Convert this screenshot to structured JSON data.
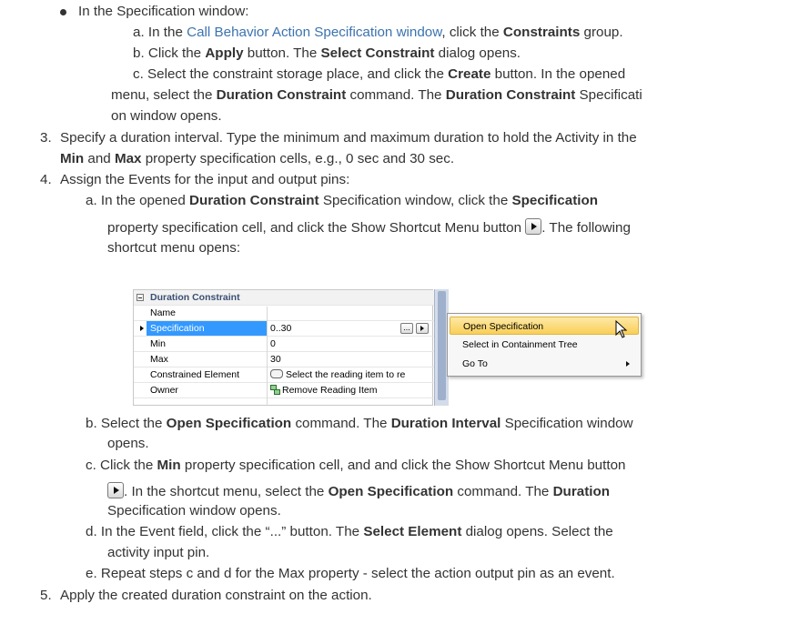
{
  "doc": {
    "bullet": {
      "intro": "In the Specification window:",
      "a_pre": "a. In the ",
      "a_link": "Call Behavior Action Specification window",
      "a_mid": ", click the ",
      "a_bold": "Constraints",
      "a_post": " group.",
      "b_pre": "b. Click the ",
      "b_bold1": "Apply",
      "b_mid": " button. The ",
      "b_bold2": "Select Constraint",
      "b_post": " dialog opens.",
      "c_pre": "c. Select the constraint storage place, and click the ",
      "c_bold1": "Create",
      "c_mid1": " button. In the opened",
      "c2_pre": "menu, select the ",
      "c2_bold1": "Duration Constraint",
      "c2_mid": " command. The ",
      "c2_bold2": "Duration Constraint",
      "c2_post": " Specificati",
      "c3": "on window opens."
    },
    "step3": {
      "num": "3.",
      "l1": "Specify a duration interval. Type the minimum and maximum duration to hold the Activity in the",
      "l2_bold1": "Min",
      "l2_mid": " and ",
      "l2_bold2": "Max",
      "l2_post": " property specification cells, e.g., 0 sec and 30 sec."
    },
    "step4": {
      "num": "4.",
      "l1": "Assign the Events for the input and output pins:",
      "a_pre": "a. In the opened ",
      "a_bold1": "Duration Constraint",
      "a_mid": " Specification window, click the ",
      "a_bold2": "Specification",
      "a2_pre": "property specification cell, and click the Show Shortcut Menu button ",
      "a2_post": ". The following",
      "a3": "shortcut menu opens:",
      "b_pre": "b. Select the ",
      "b_bold1": "Open Specification",
      "b_mid": " command. The ",
      "b_bold2": "Duration Interval",
      "b_post": " Specification window",
      "b2": "opens.",
      "c_pre": "c. Click the ",
      "c_bold": "Min",
      "c_post": " property specification cell, and and click the Show Shortcut Menu button",
      "c2_pre": ". In the shortcut menu, select the ",
      "c2_bold1": "Open Specification",
      "c2_mid": " command. The ",
      "c2_bold2": "Duration",
      "c3": "Specification window opens.",
      "d_pre": "d. In the Event field, click the “...” button. The ",
      "d_bold": "Select Element",
      "d_post": " dialog opens. Select the",
      "d2": "activity input pin.",
      "e": "e. Repeat steps c and d for the Max property - select the action output pin as an event."
    },
    "step5": {
      "num": "5.",
      "l1": "Apply the created duration constraint on the action."
    }
  },
  "screenshot": {
    "header": "Duration Constraint",
    "rows": [
      {
        "name": "Name",
        "value": ""
      },
      {
        "name": "Specification",
        "value": "0..30"
      },
      {
        "name": "Min",
        "value": "0"
      },
      {
        "name": "Max",
        "value": "30"
      },
      {
        "name": "Constrained Element",
        "value": "Select the reading item to re"
      },
      {
        "name": "Owner",
        "value": "Remove Reading Item"
      }
    ],
    "ellipsis": "...",
    "menu": {
      "items": [
        "Open Specification",
        "Select in Containment Tree",
        "Go To"
      ]
    }
  }
}
